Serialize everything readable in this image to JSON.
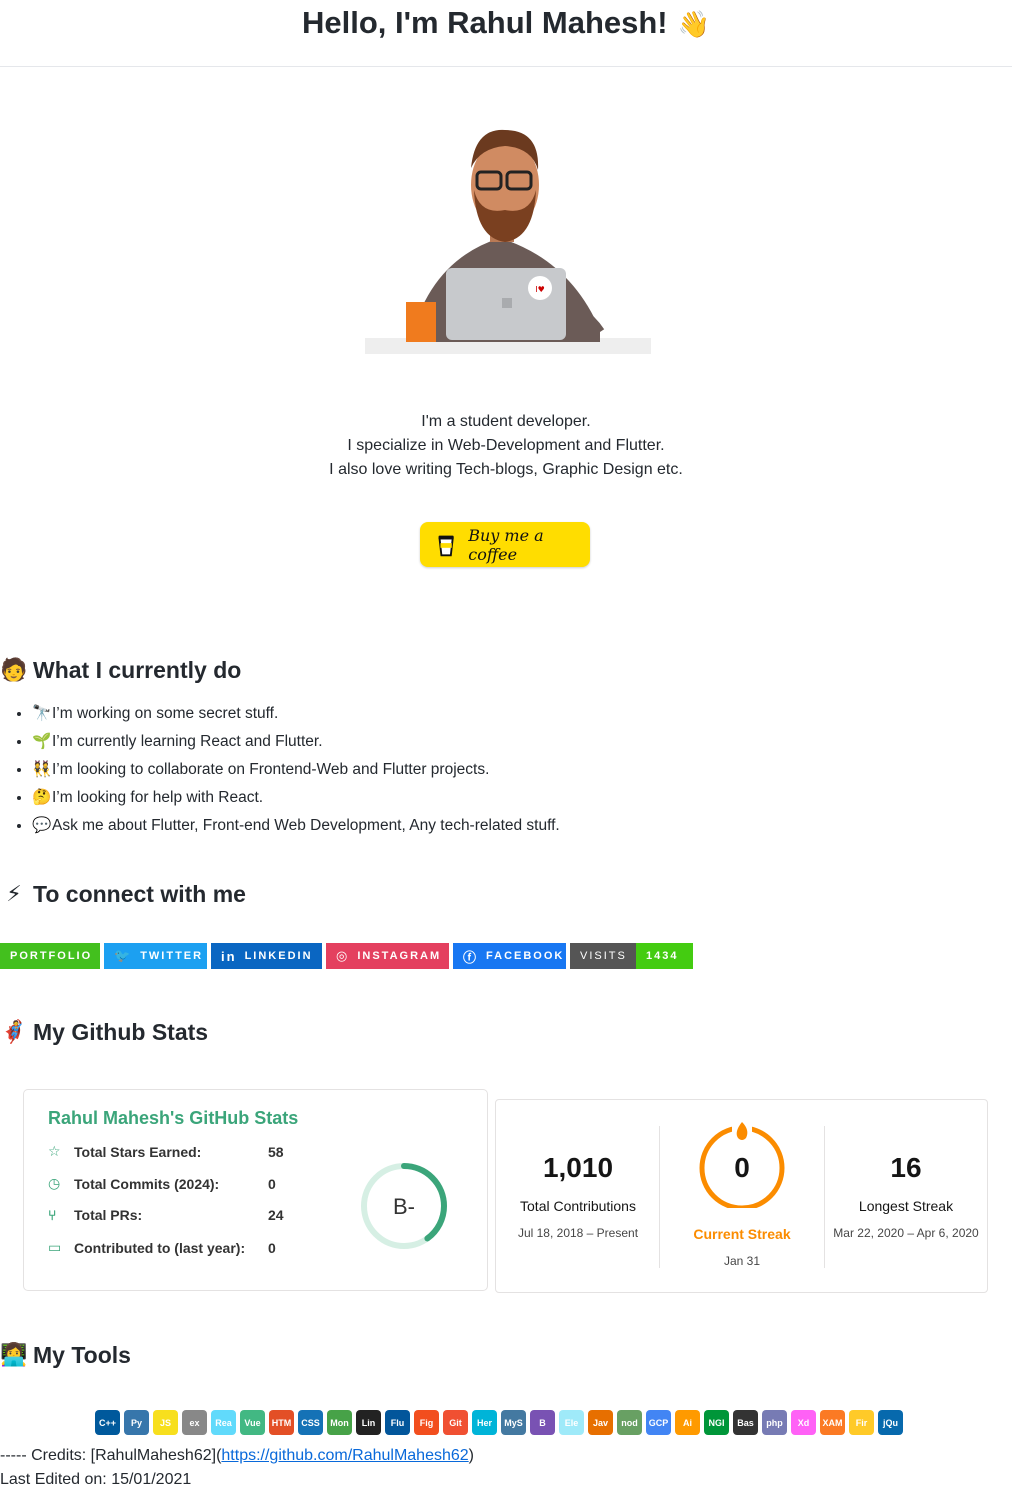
{
  "header": {
    "title": "Hello, I'm Rahul Mahesh!",
    "wave": "👋"
  },
  "intro": {
    "lines": [
      "I'm a student developer.",
      "I specialize in Web-Development and Flutter.",
      "I also love writing Tech-blogs, Graphic Design etc."
    ]
  },
  "coffee": {
    "label": "Buy me a coffee"
  },
  "sections": {
    "doing": "What I currently do",
    "connect": "To connect with me",
    "stats": "My Github Stats",
    "tools": "My Tools"
  },
  "doing_items": [
    {
      "emoji": "🔭",
      "text": "I’m working on some secret stuff."
    },
    {
      "emoji": "🌱",
      "text": "I’m currently learning React and Flutter."
    },
    {
      "emoji": "👯",
      "text": "I’m looking to collaborate on Frontend-Web and Flutter projects."
    },
    {
      "emoji": "🤔",
      "text": "I’m looking for help with React."
    },
    {
      "emoji": "💬",
      "text": "Ask me about Flutter, Front-end Web Development, Any tech-related stuff."
    }
  ],
  "badges": {
    "portfolio": "PORTFOLIO",
    "twitter": "TWITTER",
    "linkedin": "LINKEDIN",
    "instagram": "INSTAGRAM",
    "facebook": "FACEBOOK",
    "visits_label": "VISITS",
    "visits_count": "1434"
  },
  "stats_card": {
    "title": "Rahul Mahesh's GitHub Stats",
    "rows": [
      {
        "label": "Total Stars Earned:",
        "value": "58",
        "icon": "star-icon"
      },
      {
        "label": "Total Commits (2024):",
        "value": "0",
        "icon": "clock-icon"
      },
      {
        "label": "Total PRs:",
        "value": "24",
        "icon": "pr-icon"
      },
      {
        "label": "Contributed to (last year):",
        "value": "0",
        "icon": "repo-icon"
      }
    ],
    "grade": "B-",
    "grade_progress": 0.4
  },
  "streak_card": {
    "total": {
      "value": "1,010",
      "label": "Total Contributions",
      "date": "Jul 18, 2018 – Present"
    },
    "current": {
      "value": "0",
      "label": "Current Streak",
      "date": "Jan 31"
    },
    "longest": {
      "value": "16",
      "label": "Longest Streak",
      "date": "Mar 22, 2020 – Apr 6, 2020"
    }
  },
  "tools": [
    "C++",
    "Py",
    "JS",
    "ex",
    "React",
    "Vue",
    "HTML",
    "CSS",
    "Mongo",
    "Linux",
    "Flutter",
    "Figma",
    "Git",
    "Heroku",
    "MySQL",
    "B",
    "Elec",
    "Java",
    "node",
    "GCP",
    "Ai",
    "NGINX",
    "Bash",
    "php",
    "Xd",
    "XAMPP",
    "Firebase",
    "jQuery"
  ],
  "credits": {
    "prefix": "----- Credits: [RahulMahesh62](",
    "link": "https://github.com/RahulMahesh62",
    "suffix": ")",
    "edited": "Last Edited on: 15/01/2021"
  },
  "colors": {
    "portfolio": "#43c01e",
    "twitter": "#1ca0f1",
    "linkedin": "#0a66c2",
    "instagram": "#e4405f",
    "facebook": "#1877f2",
    "visits_left": "#555555",
    "visits_right": "#4c1",
    "coffee": "#FFDD00",
    "stats_accent": "#3ba57a",
    "streak_orange": "#fb8c00"
  }
}
